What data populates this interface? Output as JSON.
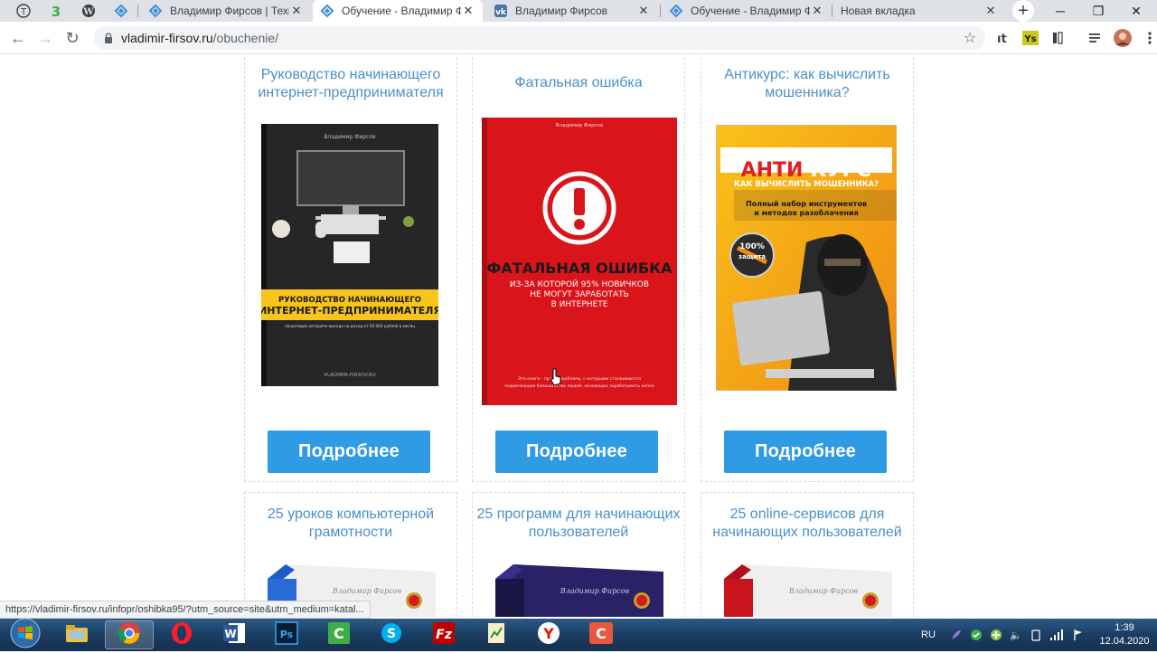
{
  "browser": {
    "tabs": [
      {
        "title": "Владимир Фирсов | Технологии",
        "active": false
      },
      {
        "title": "Обучение - Владимир Фирсов",
        "active": true
      },
      {
        "title": "Владимир Фирсов",
        "active": false
      },
      {
        "title": "Обучение - Владимир Фирсов",
        "active": false
      },
      {
        "title": "Новая вкладка",
        "active": false
      }
    ],
    "pinned_icons": [
      "telegraph-icon",
      "number-three-icon",
      "wordpress-icon",
      "firsov-site-icon"
    ],
    "url_host": "vladimir-firsov.ru",
    "url_path": "/obuchenie/",
    "extension_icons": [
      "translate-icon",
      "yandex-seo-icon",
      "bookmark-icon",
      "reading-list-icon",
      "profile-avatar",
      "menu-icon"
    ],
    "status_url": "https://vladimir-firsov.ru/infopr/oshibka95/?utm_source=site&utm_medium=katal..."
  },
  "cards": [
    {
      "title_line1": "Руководство начинающего",
      "title_line2": "интернет-предпринимателя",
      "button": "Подробнее",
      "cover": {
        "author": "Владимир Фирсов",
        "band_line1": "РУКОВОДСТВО НАЧИНАЮЩЕГО",
        "band_line2": "ИНТЕРНЕТ-ПРЕДПРИНИМАТЕЛЯ",
        "sub": "пошаговый алгоритм выхода на доход от 50 000 рублей в месяц",
        "footer": "VLADIMIR-FIRSOV.RU"
      }
    },
    {
      "title_line1": "Фатальная ошибка",
      "title_line2": "",
      "button": "Подробнее",
      "cover": {
        "author": "Владимир Фирсов",
        "headline": "ФАТАЛЬНАЯ ОШИБКА",
        "sub1": "ИЗ-ЗА КОТОРОЙ 95% НОВИЧКОВ",
        "sub2": "НЕ МОГУТ ЗАРАБОТАТЬ",
        "sub3": "В ИНТЕРНЕТЕ",
        "footer1": "Эта книга - про ту проблему, с которыми сталкиваются",
        "footer2": "подавляющее большинство людей, желающих зарабатывать online"
      }
    },
    {
      "title_line1": "Антикурс: как вычислить",
      "title_line2": "мошенника?",
      "button": "Подробнее",
      "cover": {
        "top": "РУКОВОДСТВО",
        "brand1": "АНТИ",
        "brand2": "КУРС",
        "question": "КАК ВЫЧИСЛИТЬ МОШЕННИКА?",
        "sub1": "Полный набор инструментов",
        "sub2": "и методов разоблачения",
        "badge1": "100%",
        "badge2": "защита"
      }
    },
    {
      "title_line1": "25 уроков компьютерной",
      "title_line2": "грамотности",
      "button": "",
      "cover": {
        "author": "Владимир Фирсов"
      }
    },
    {
      "title_line1": "25 программ для начинающих",
      "title_line2": "пользователей",
      "button": "",
      "cover": {
        "author": "Владимир Фирсов"
      }
    },
    {
      "title_line1": "25 online-сервисов для",
      "title_line2": "начинающих пользователей",
      "button": "",
      "cover": {
        "author": "Владимир Фирсов"
      }
    }
  ],
  "taskbar": {
    "apps": [
      "windows-explorer-icon",
      "chrome-icon",
      "opera-icon",
      "word-icon",
      "photoshop-icon",
      "camtasia-icon",
      "skype-icon",
      "filezilla-icon",
      "notepad-icon",
      "yandex-browser-icon",
      "camtasia-recorder-icon"
    ],
    "lang": "RU",
    "time": "1:39",
    "date": "12.04.2020"
  },
  "colors": {
    "accent_blue": "#2f9be4",
    "title_blue": "#4a90c8",
    "red_cover": "#d9151b",
    "yellow_band": "#f7c51b"
  }
}
